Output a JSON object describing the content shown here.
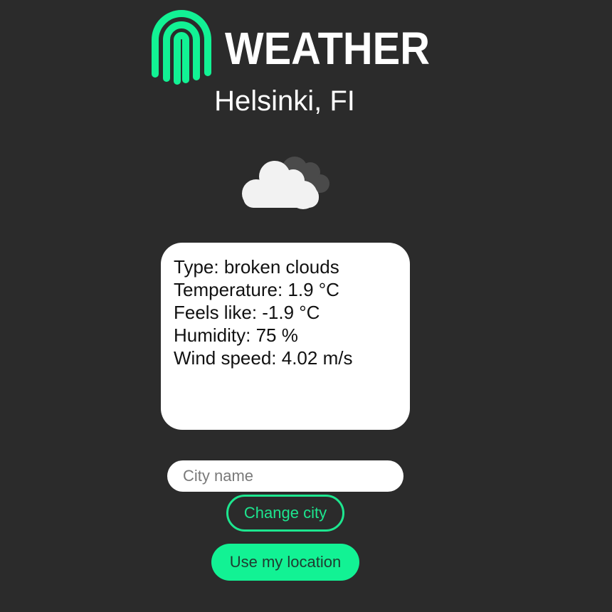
{
  "header": {
    "logo_icon": "fingerprint-logo-icon",
    "logo_word": "WEATHER",
    "brand_color": "#12f294"
  },
  "location": {
    "city": "Helsinki, FI"
  },
  "weather_icon": "broken-clouds-icon",
  "details": {
    "type": "Type: broken clouds",
    "temperature": "Temperature: 1.9 °C",
    "feels_like": "Feels like: -1.9 °C",
    "humidity": "Humidity: 75 %",
    "wind_speed": "Wind speed: 4.02 m/s"
  },
  "controls": {
    "city_input_placeholder": "City name",
    "city_input_value": "",
    "change_city_label": "Change city",
    "use_location_label": "Use my location"
  },
  "colors": {
    "background": "#2b2b2b",
    "accent": "#12f294",
    "card": "#ffffff"
  }
}
